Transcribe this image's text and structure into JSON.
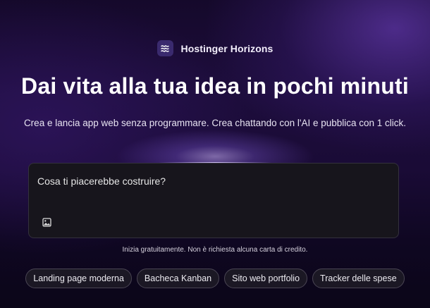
{
  "brand": {
    "logo_icon": "hostinger-horizons-logo-icon",
    "name": "Hostinger Horizons"
  },
  "hero": {
    "title": "Dai vita alla tua idea in pochi minuti",
    "subtitle": "Crea e lancia app web senza programmare. Crea chattando con l'AI e pubblica con 1 click."
  },
  "prompt": {
    "placeholder": "Cosa ti piacerebbe costruire?",
    "value": "",
    "attach_icon": "image-icon"
  },
  "note": "Inizia gratuitamente. Non è richiesta alcuna carta di credito.",
  "suggestions": [
    {
      "label": "Landing page moderna"
    },
    {
      "label": "Bacheca Kanban"
    },
    {
      "label": "Sito web portfolio"
    },
    {
      "label": "Tracker delle spese"
    }
  ],
  "colors": {
    "background_top": "#1d0d3c",
    "background_bottom": "#0b0618",
    "logo_bg": "#3a2a6e",
    "prompt_bg": "#17151c",
    "chip_border": "#4a4554"
  }
}
